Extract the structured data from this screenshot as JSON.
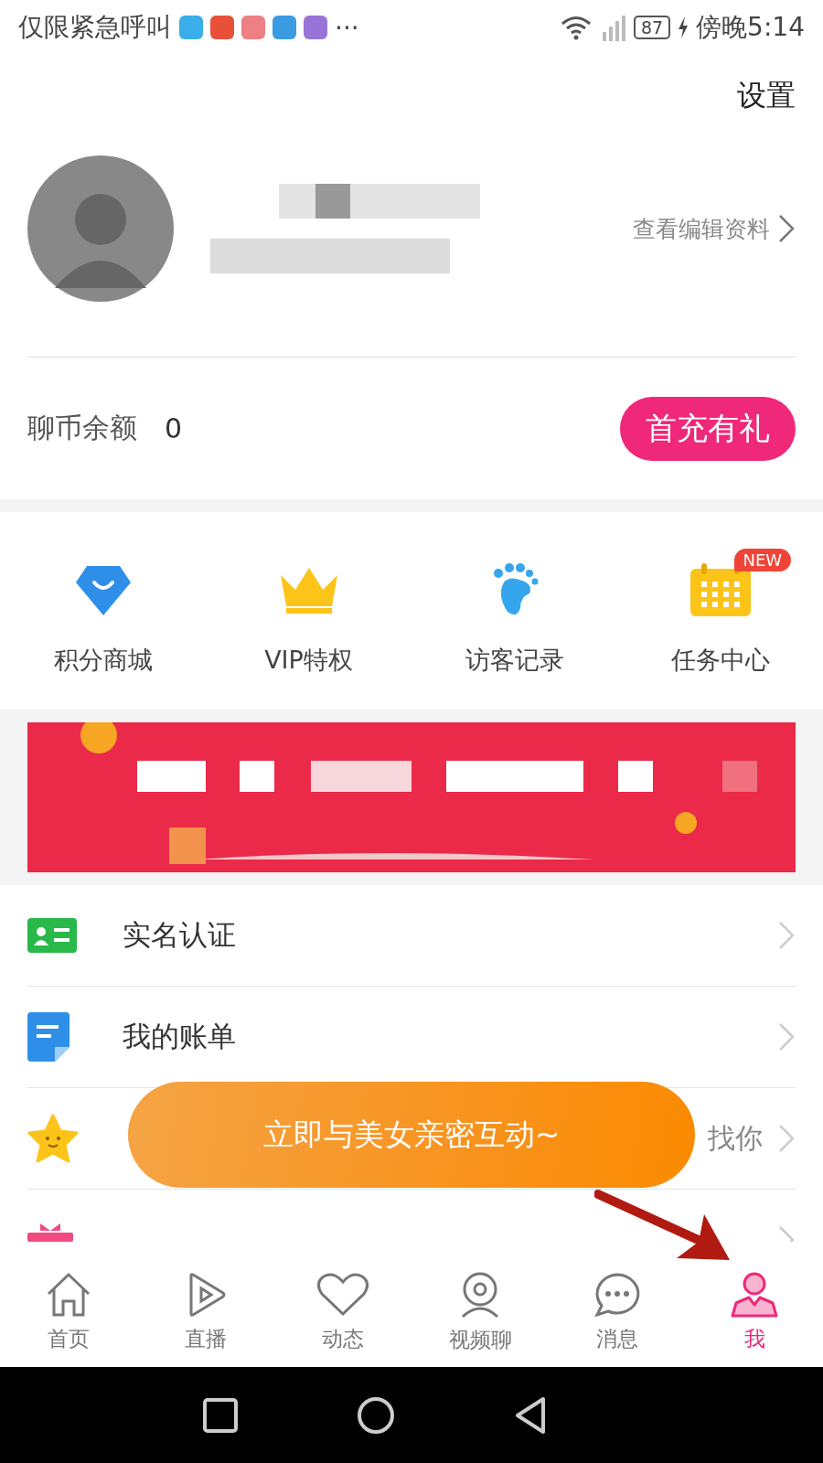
{
  "status_bar": {
    "carrier": "仅限紧急呼叫",
    "battery": "87",
    "time": "傍晚5:14",
    "more": "···"
  },
  "header": {
    "settings": "设置"
  },
  "profile": {
    "edit_link": "查看编辑资料"
  },
  "balance": {
    "label": "聊币余额",
    "value": "0",
    "button": "首充有礼"
  },
  "shortcuts": [
    {
      "kind": "shop",
      "label": "积分商城"
    },
    {
      "kind": "vip",
      "label": "VIP特权"
    },
    {
      "kind": "visitor",
      "label": "访客记录"
    },
    {
      "kind": "task",
      "label": "任务中心",
      "badge": "NEW"
    }
  ],
  "menu": [
    {
      "kind": "id",
      "label": "实名认证"
    },
    {
      "kind": "bill",
      "label": "我的账单"
    },
    {
      "kind": "star",
      "hint": "找你"
    },
    {
      "kind": "gift"
    }
  ],
  "toast": "立即与美女亲密互动~",
  "tab_bar": [
    {
      "kind": "home",
      "label": "首页",
      "selected": false
    },
    {
      "kind": "live",
      "label": "直播",
      "selected": false
    },
    {
      "kind": "feed",
      "label": "动态",
      "selected": false
    },
    {
      "kind": "video",
      "label": "视频聊",
      "selected": false
    },
    {
      "kind": "message",
      "label": "消息",
      "selected": false
    },
    {
      "kind": "me",
      "label": "我",
      "selected": true
    }
  ]
}
